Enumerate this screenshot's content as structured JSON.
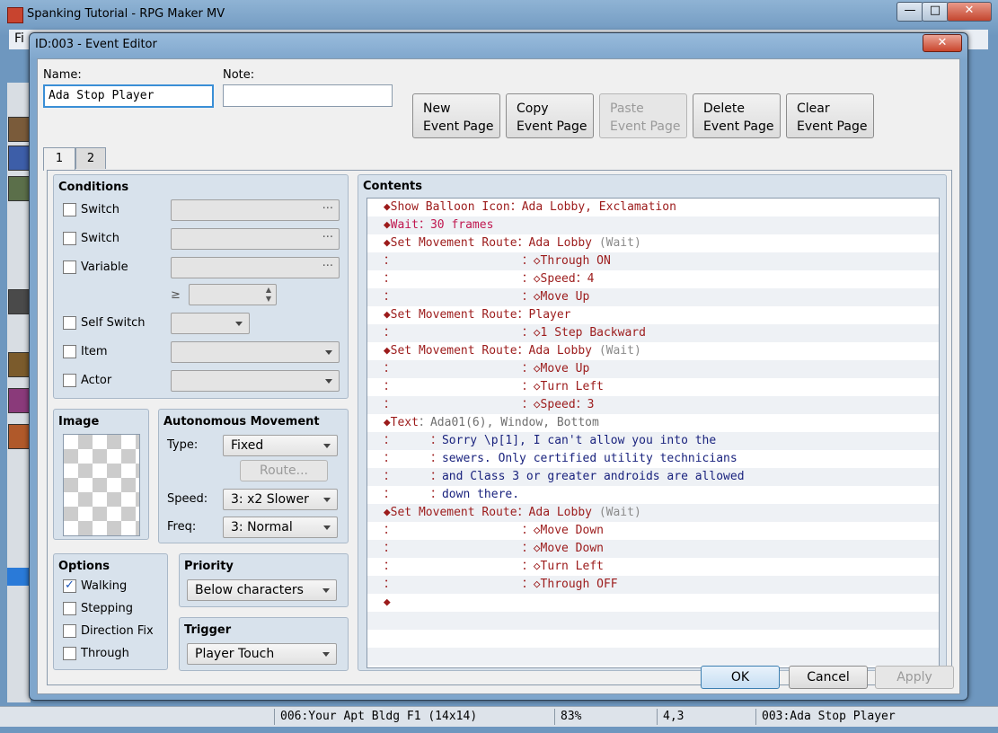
{
  "window": {
    "title": "Spanking Tutorial - RPG Maker MV",
    "menu_first": "Fi",
    "minimize": "—",
    "maximize": "□",
    "close": "✕"
  },
  "status_bar": {
    "map": "006:Your Apt Bldg F1 (14x14)",
    "zoom": "83%",
    "coords": "4,3",
    "event": "003:Ada Stop Player"
  },
  "dialog": {
    "title": "ID:003 - Event Editor",
    "close": "✕",
    "name_label": "Name:",
    "name_value": "Ada Stop Player",
    "note_label": "Note:",
    "note_value": "",
    "buttons": {
      "new": [
        "New",
        "Event Page"
      ],
      "copy": [
        "Copy",
        "Event Page"
      ],
      "paste": [
        "Paste",
        "Event Page"
      ],
      "delete": [
        "Delete",
        "Event Page"
      ],
      "clear": [
        "Clear",
        "Event Page"
      ]
    },
    "tabs": [
      "1",
      "2"
    ],
    "conditions": {
      "title": "Conditions",
      "switch1": "Switch",
      "switch2": "Switch",
      "variable": "Variable",
      "gte": "≥",
      "self_switch": "Self Switch",
      "item": "Item",
      "actor": "Actor",
      "ellipsis": "···"
    },
    "image": {
      "title": "Image"
    },
    "autonomous": {
      "title": "Autonomous Movement",
      "type_label": "Type:",
      "type_value": "Fixed",
      "route_button": "Route...",
      "speed_label": "Speed:",
      "speed_value": "3: x2 Slower",
      "freq_label": "Freq:",
      "freq_value": "3: Normal"
    },
    "options": {
      "title": "Options",
      "walking": "Walking",
      "walking_checked": "✓",
      "stepping": "Stepping",
      "direction_fix": "Direction Fix",
      "through": "Through"
    },
    "priority": {
      "title": "Priority",
      "value": "Below characters"
    },
    "trigger": {
      "title": "Trigger",
      "value": "Player Touch"
    },
    "contents_title": "Contents",
    "footer": {
      "ok": "OK",
      "cancel": "Cancel",
      "apply": "Apply"
    }
  },
  "contents": [
    {
      "parts": [
        [
          "◆Show Balloon Icon：Ada Lobby, Exclamation",
          "c-red"
        ]
      ]
    },
    {
      "parts": [
        [
          "◆",
          "c-red"
        ],
        [
          "Wait：30 frames",
          "c-mag"
        ]
      ]
    },
    {
      "parts": [
        [
          "◆Set Movement Route：Ada Lobby ",
          "c-red"
        ],
        [
          "(Wait)",
          "c-gray"
        ]
      ]
    },
    {
      "parts": [
        [
          "：                  ：◇Through ON",
          "c-red"
        ]
      ]
    },
    {
      "parts": [
        [
          "：                  ：◇Speed：4",
          "c-red"
        ]
      ]
    },
    {
      "parts": [
        [
          "：                  ：◇Move Up",
          "c-red"
        ]
      ]
    },
    {
      "parts": [
        [
          "◆Set Movement Route：Player",
          "c-red"
        ]
      ]
    },
    {
      "parts": [
        [
          "：                  ：◇1 Step Backward",
          "c-red"
        ]
      ]
    },
    {
      "parts": [
        [
          "◆Set Movement Route：Ada Lobby ",
          "c-red"
        ],
        [
          "(Wait)",
          "c-gray"
        ]
      ]
    },
    {
      "parts": [
        [
          "：                  ：◇Move Up",
          "c-red"
        ]
      ]
    },
    {
      "parts": [
        [
          "：                  ：◇Turn Left",
          "c-red"
        ]
      ]
    },
    {
      "parts": [
        [
          "：                  ：◇Speed：3",
          "c-red"
        ]
      ]
    },
    {
      "parts": [
        [
          "◆Text",
          "c-red"
        ],
        [
          "：Ada01(6), Window, Bottom",
          "c-gray2"
        ]
      ]
    },
    {
      "parts": [
        [
          "：     ：",
          "c-red"
        ],
        [
          "Sorry \\p[1], I can't allow you into the",
          "c-blue"
        ]
      ]
    },
    {
      "parts": [
        [
          "：     ：",
          "c-red"
        ],
        [
          "sewers. Only certified utility technicians",
          "c-blue"
        ]
      ]
    },
    {
      "parts": [
        [
          "：     ：",
          "c-red"
        ],
        [
          "and Class 3 or greater androids are allowed",
          "c-blue"
        ]
      ]
    },
    {
      "parts": [
        [
          "：     ：",
          "c-red"
        ],
        [
          "down there.",
          "c-blue"
        ]
      ]
    },
    {
      "parts": [
        [
          "◆Set Movement Route：Ada Lobby ",
          "c-red"
        ],
        [
          "(Wait)",
          "c-gray"
        ]
      ]
    },
    {
      "parts": [
        [
          "：                  ：◇Move Down",
          "c-red"
        ]
      ]
    },
    {
      "parts": [
        [
          "：                  ：◇Move Down",
          "c-red"
        ]
      ]
    },
    {
      "parts": [
        [
          "：                  ：◇Turn Left",
          "c-red"
        ]
      ]
    },
    {
      "parts": [
        [
          "：                  ：◇Through OFF",
          "c-red"
        ]
      ]
    },
    {
      "parts": [
        [
          "◆",
          "c-red"
        ]
      ]
    }
  ]
}
